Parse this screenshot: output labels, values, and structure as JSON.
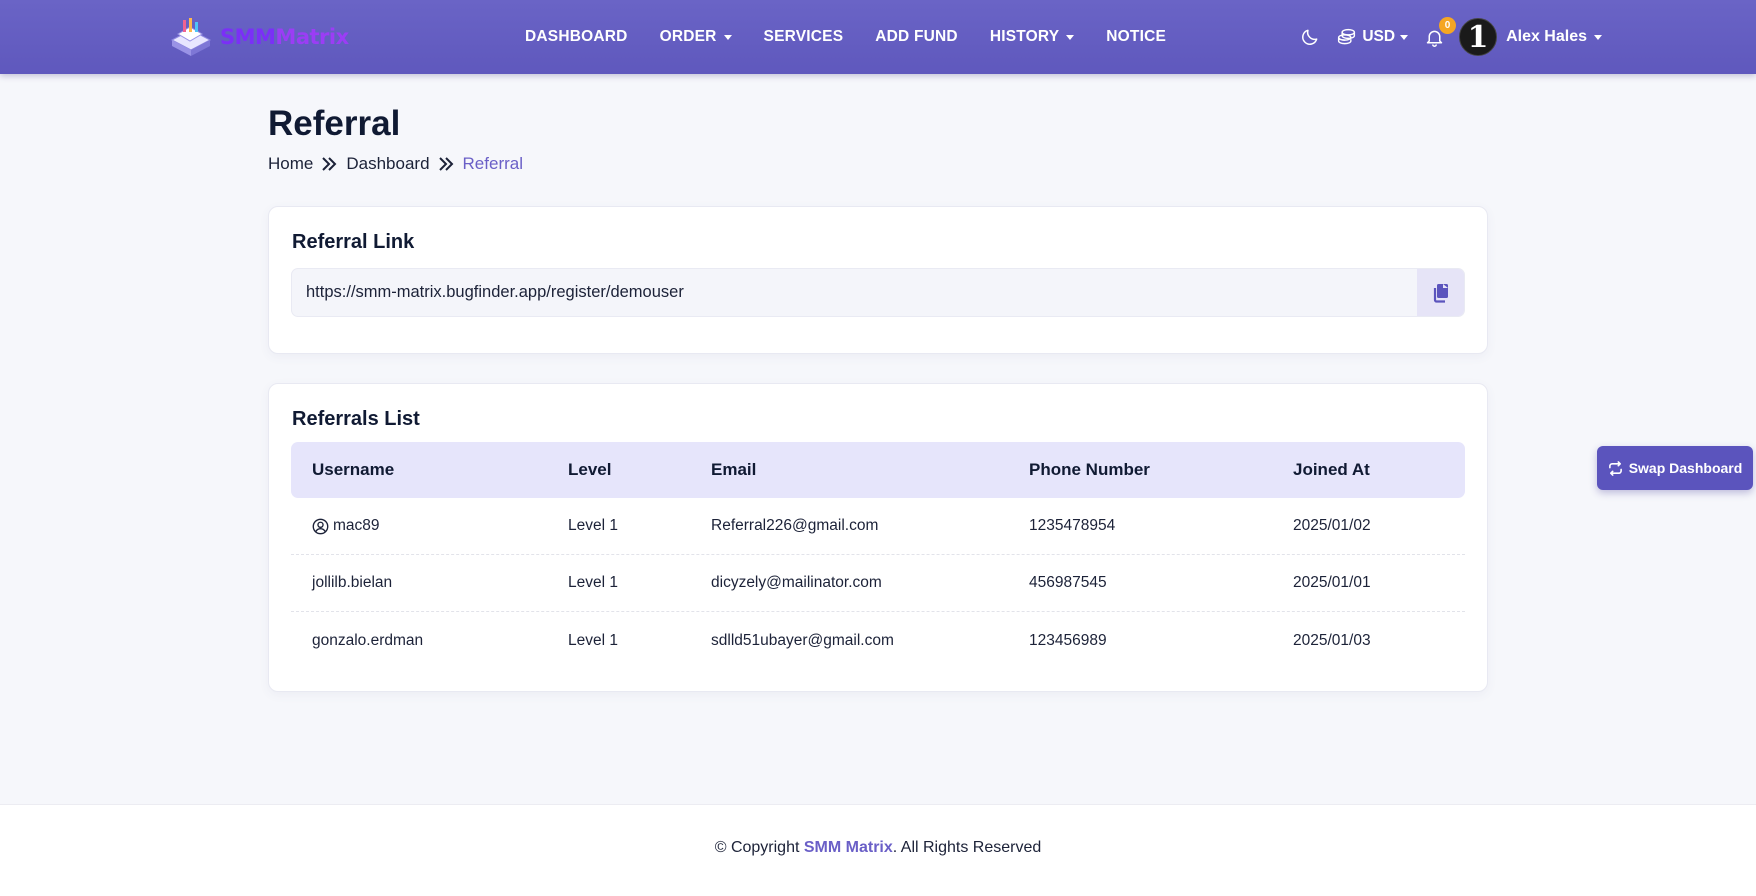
{
  "header": {
    "logo": {
      "text_part1": "SMM",
      "text_part2": "Matrix"
    },
    "nav": [
      {
        "label": "DASHBOARD",
        "dropdown": false
      },
      {
        "label": "ORDER",
        "dropdown": true
      },
      {
        "label": "SERVICES",
        "dropdown": false
      },
      {
        "label": "ADD FUND",
        "dropdown": false
      },
      {
        "label": "HISTORY",
        "dropdown": true
      },
      {
        "label": "NOTICE",
        "dropdown": false
      }
    ],
    "theme_icon": "moon-icon",
    "currency": "USD",
    "notifications_count": "0",
    "avatar_text": "1",
    "user_name": "Alex Hales"
  },
  "page": {
    "title": "Referral",
    "breadcrumb": [
      "Home",
      "Dashboard",
      "Referral"
    ]
  },
  "referral_link": {
    "title": "Referral Link",
    "url": "https://smm-matrix.bugfinder.app/register/demouser",
    "copy_icon": "copy-icon"
  },
  "referrals_list": {
    "title": "Referrals List",
    "columns": [
      "Username",
      "Level",
      "Email",
      "Phone Number",
      "Joined At"
    ],
    "rows": [
      {
        "username": "mac89",
        "level": "Level 1",
        "email": "Referral226@gmail.com",
        "phone": "1235478954",
        "joined": "2025/01/02",
        "icon": "user-circle-icon"
      },
      {
        "username": "jollilb.bielan",
        "level": "Level 1",
        "email": "dicyzely@mailinator.com",
        "phone": "456987545",
        "joined": "2025/01/01"
      },
      {
        "username": "gonzalo.erdman",
        "level": "Level 1",
        "email": "sdlld51ubayer@gmail.com",
        "phone": "123456989",
        "joined": "2025/01/03"
      }
    ]
  },
  "swap_button": {
    "label": "Swap Dashboard",
    "icon": "swap-icon"
  },
  "footer": {
    "prefix": "© Copyright ",
    "brand": "SMM Matrix",
    "suffix": ". All Rights Reserved"
  },
  "colors": {
    "header": "#5f58bd",
    "accent": "#6a5fc7",
    "badge": "#f5a623",
    "table_head": "#e6e5fb"
  }
}
